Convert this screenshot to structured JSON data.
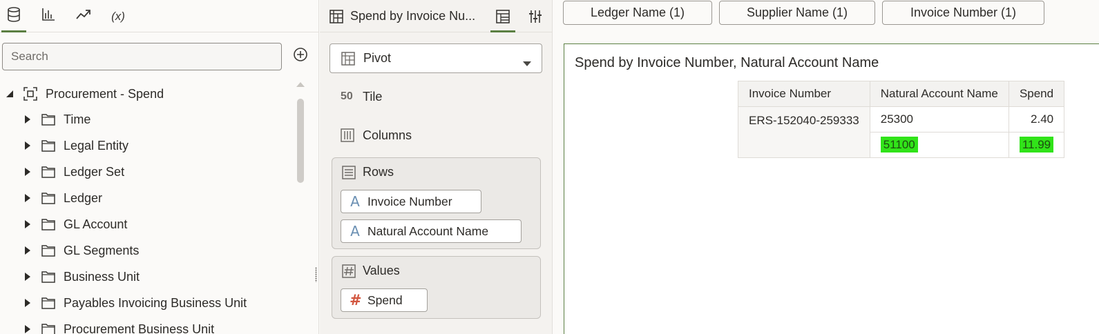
{
  "left_panel": {
    "tabs": [
      {
        "name": "data",
        "icon": "database-icon"
      },
      {
        "name": "visualizations",
        "icon": "bar-chart-icon"
      },
      {
        "name": "analytics",
        "icon": "trend-icon"
      },
      {
        "name": "calculations",
        "label": "(x)"
      }
    ],
    "search": {
      "placeholder": "Search",
      "value": ""
    },
    "add_icon": "plus-circle-icon",
    "tree": {
      "root": {
        "label": "Procurement - Spend",
        "expanded": true,
        "icon": "subject-area-icon"
      },
      "folders": [
        "Time",
        "Legal Entity",
        "Ledger Set",
        "Ledger",
        "GL Account",
        "GL Segments",
        "Business Unit",
        "Payables Invoicing Business Unit",
        "Procurement Business Unit"
      ]
    }
  },
  "middle_panel": {
    "viz_title": "Spend by Invoice Nu...",
    "viz_type": "Pivot",
    "grammar": {
      "tile_label": "Tile",
      "tile_icon_text": "50",
      "columns_label": "Columns",
      "rows_label": "Rows",
      "rows_items": [
        "Invoice Number",
        "Natural Account Name"
      ],
      "values_label": "Values",
      "values_items": [
        "Spend"
      ]
    }
  },
  "filters": [
    "Ledger Name (1)",
    "Supplier Name (1)",
    "Invoice Number (1)"
  ],
  "canvas": {
    "title": "Spend by Invoice Number, Natural Account Name",
    "table": {
      "headers": [
        "Invoice Number",
        "Natural Account Name",
        "Spend"
      ],
      "invoice": "ERS-152040-259333",
      "rows": [
        {
          "account": "25300",
          "spend": "2.40",
          "highlighted": false
        },
        {
          "account": "51100",
          "spend": "11.99",
          "highlighted": true
        }
      ]
    }
  },
  "colors": {
    "accent": "#5b7f42",
    "highlight": "#31e319",
    "attribute": "#6b90b3",
    "measure": "#d2563f"
  }
}
